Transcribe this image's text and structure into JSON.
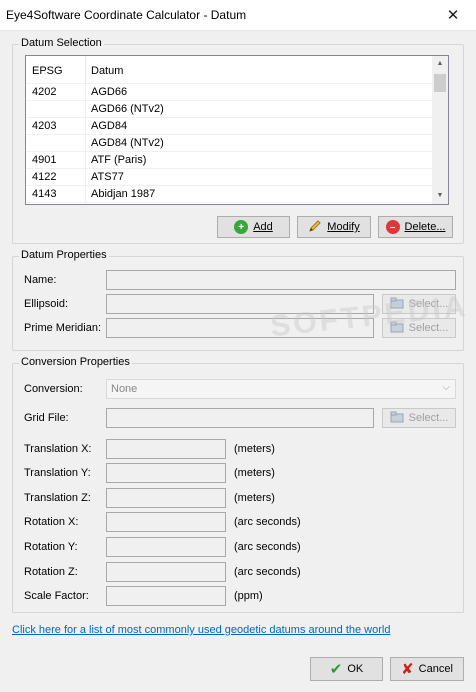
{
  "window": {
    "title": "Eye4Software Coordinate Calculator - Datum",
    "close_glyph": "✕"
  },
  "datum_selection": {
    "label": "Datum Selection",
    "columns": [
      "EPSG",
      "Datum"
    ],
    "rows": [
      {
        "epsg": "4202",
        "datum": "AGD66"
      },
      {
        "epsg": "",
        "datum": "AGD66 (NTv2)"
      },
      {
        "epsg": "4203",
        "datum": "AGD84"
      },
      {
        "epsg": "",
        "datum": "AGD84 (NTv2)"
      },
      {
        "epsg": "4901",
        "datum": "ATF (Paris)"
      },
      {
        "epsg": "4122",
        "datum": "ATS77"
      },
      {
        "epsg": "4143",
        "datum": "Abidjan 1987"
      }
    ],
    "add_label": "Add",
    "modify_label": "Modify",
    "delete_label": "Delete..."
  },
  "datum_properties": {
    "label": "Datum Properties",
    "name_label": "Name:",
    "ellipsoid_label": "Ellipsoid:",
    "prime_meridian_label": "Prime Meridian:",
    "select_label": "Select..."
  },
  "conversion_properties": {
    "label": "Conversion Properties",
    "conversion_label": "Conversion:",
    "conversion_value": "None",
    "grid_file_label": "Grid File:",
    "select_label": "Select...",
    "params": [
      {
        "label": "Translation X:",
        "unit": "(meters)"
      },
      {
        "label": "Translation Y:",
        "unit": "(meters)"
      },
      {
        "label": "Translation Z:",
        "unit": "(meters)"
      },
      {
        "label": "Rotation X:",
        "unit": "(arc seconds)"
      },
      {
        "label": "Rotation Y:",
        "unit": "(arc seconds)"
      },
      {
        "label": "Rotation Z:",
        "unit": "(arc seconds)"
      },
      {
        "label": "Scale Factor:",
        "unit": "(ppm)"
      }
    ]
  },
  "link_text": "Click here for a list of most commonly used geodetic datums around the world",
  "ok_label": "OK",
  "cancel_label": "Cancel",
  "watermark": "SOFTPEDIA",
  "colors": {
    "add_icon": "#3aa53a",
    "delete_icon": "#d93a3a",
    "ok_check": "#2e9e2e",
    "cancel_x": "#d02020",
    "link": "#0066cc"
  }
}
